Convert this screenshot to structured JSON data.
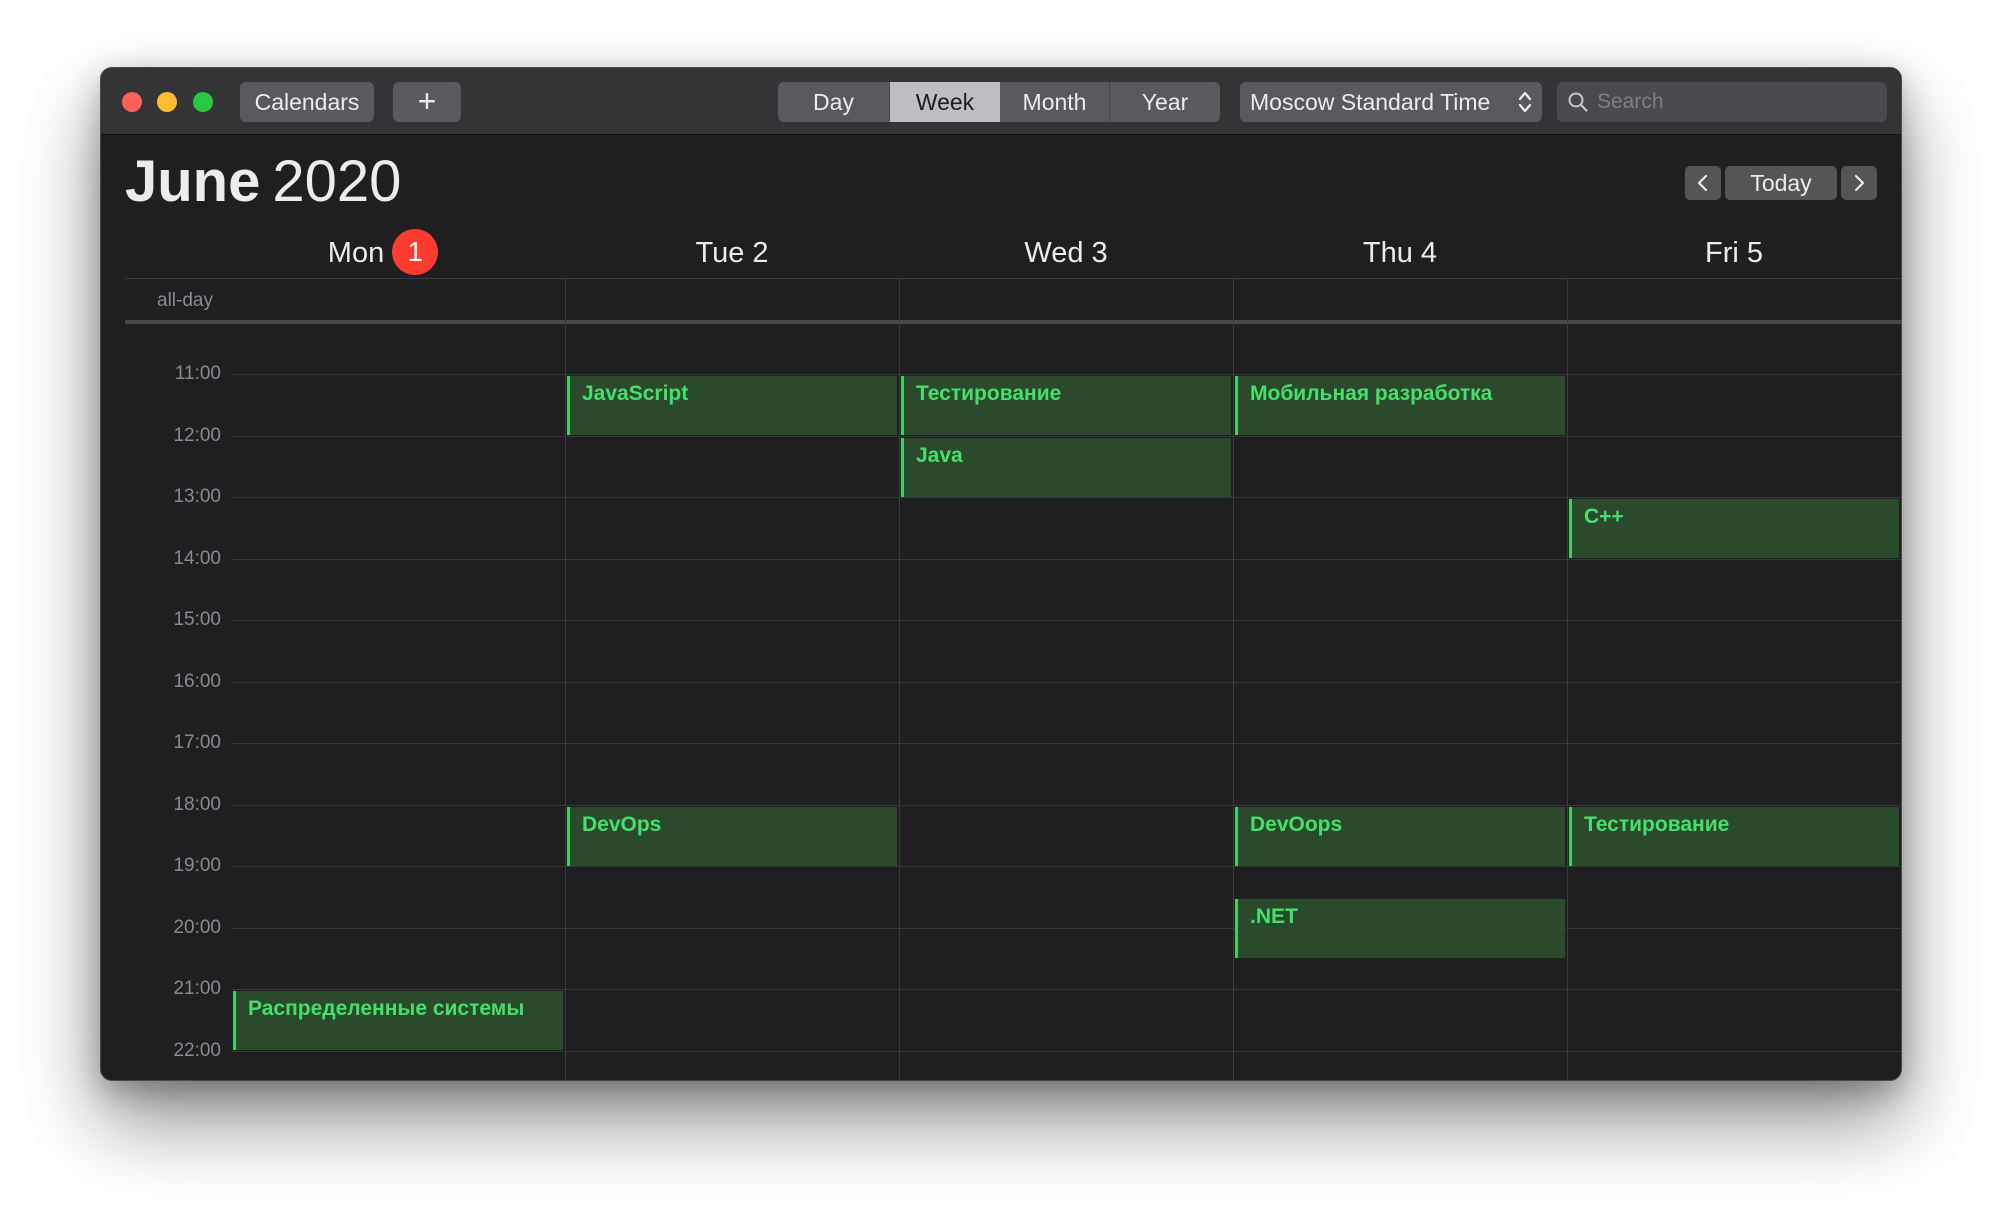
{
  "toolbar": {
    "calendars_label": "Calendars",
    "add_label": "+",
    "views": [
      "Day",
      "Week",
      "Month",
      "Year"
    ],
    "selected_view": "Week",
    "timezone": "Moscow Standard Time",
    "search_placeholder": "Search"
  },
  "header": {
    "month": "June",
    "year": "2020",
    "today_label": "Today"
  },
  "days": [
    {
      "name": "Mon",
      "number": "1",
      "is_today": true
    },
    {
      "name": "Tue 2"
    },
    {
      "name": "Wed 3"
    },
    {
      "name": "Thu 4"
    },
    {
      "name": "Fri 5"
    }
  ],
  "allday_label": "all-day",
  "hours": [
    "11:00",
    "12:00",
    "13:00",
    "14:00",
    "15:00",
    "16:00",
    "17:00",
    "18:00",
    "19:00",
    "20:00",
    "21:00",
    "22:00"
  ],
  "events": [
    {
      "title": "JavaScript",
      "day": "Tue 2",
      "start": "11:00",
      "end": "12:00"
    },
    {
      "title": "Тестирование",
      "day": "Wed 3",
      "start": "11:00",
      "end": "12:00"
    },
    {
      "title": "Мобильная разработка",
      "day": "Thu 4",
      "start": "11:00",
      "end": "12:00"
    },
    {
      "title": "Java",
      "day": "Wed 3",
      "start": "12:00",
      "end": "13:00"
    },
    {
      "title": "C++",
      "day": "Fri 5",
      "start": "13:00",
      "end": "14:00"
    },
    {
      "title": "DevOps",
      "day": "Tue 2",
      "start": "18:00",
      "end": "19:00"
    },
    {
      "title": "DevOops",
      "day": "Thu 4",
      "start": "18:00",
      "end": "19:00"
    },
    {
      "title": "Тестирование",
      "day": "Fri 5",
      "start": "18:00",
      "end": "19:00"
    },
    {
      "title": ".NET",
      "day": "Thu 4",
      "start": "19:30",
      "end": "20:30"
    },
    {
      "title": "Распределенные системы",
      "day": "Mon",
      "start": "21:00",
      "end": "22:00"
    }
  ],
  "colors": {
    "event_bg": "#2b4a2c",
    "event_accent": "#3bd35e",
    "event_text": "#44e06b",
    "today_badge": "#ff3b30"
  }
}
